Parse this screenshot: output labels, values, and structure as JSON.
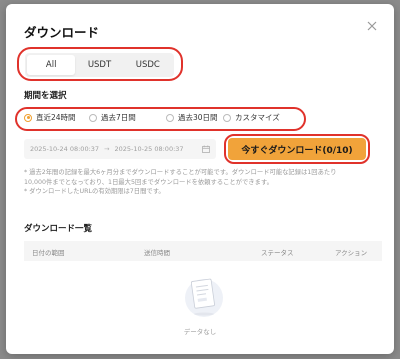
{
  "dialog": {
    "title": "ダウンロード",
    "close_icon": "close-icon"
  },
  "asset_tabs": {
    "items": [
      {
        "label": "All",
        "active": true
      },
      {
        "label": "USDT",
        "active": false
      },
      {
        "label": "USDC",
        "active": false
      }
    ]
  },
  "period": {
    "label": "期間を選択",
    "options": [
      {
        "label": "直近24時間",
        "checked": true
      },
      {
        "label": "過去7日間",
        "checked": false
      },
      {
        "label": "過去30日間",
        "checked": false
      },
      {
        "label": "カスタマイズ",
        "checked": false
      }
    ]
  },
  "date_range": {
    "start": "2025-10-24 08:00:37",
    "end": "2025-10-25 08:00:37",
    "calendar_icon": "calendar-icon"
  },
  "download_button": {
    "label": "今すぐダウンロード(0/10)",
    "color": "#f1a33a"
  },
  "notes": [
    "* 過去2年間の記録を最大6ヶ月分までダウンロードすることが可能です。ダウンロード可能な記録は1回あたり",
    "10,000件までとなっており、1日最大5回までダウンロードを依頼することができます。",
    "* ダウンロードしたURLの有効期限は7日間です。"
  ],
  "download_list": {
    "title": "ダウンロード一覧",
    "columns": [
      "日付の範囲",
      "送信時間",
      "ステータス",
      "アクション"
    ],
    "empty_text": "データなし"
  },
  "colors": {
    "highlight_ring": "#e0322b",
    "radio_accent": "#f0a030"
  }
}
